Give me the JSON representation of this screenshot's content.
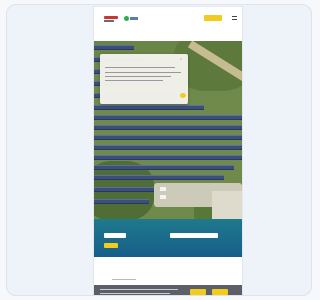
{
  "header": {
    "nav_links": [
      "",
      "",
      ""
    ],
    "cta_label": "",
    "language": "",
    "small_text": ""
  },
  "nav": {
    "items": [
      "",
      "",
      "",
      "",
      "",
      ""
    ]
  },
  "dialog": {
    "title": "",
    "close": "×",
    "dismiss_label": ""
  },
  "search": {
    "input1_placeholder": "",
    "input2_placeholder": "",
    "go_label": ""
  },
  "section": {
    "title": ""
  },
  "cookie": {
    "accept_label": "",
    "more_label": ""
  },
  "colors": {
    "accent": "#f2cc1c",
    "teal": "#1e7a8c",
    "panel_blue": "#3b4f7d",
    "cookie_bg": "#5c5f66"
  }
}
